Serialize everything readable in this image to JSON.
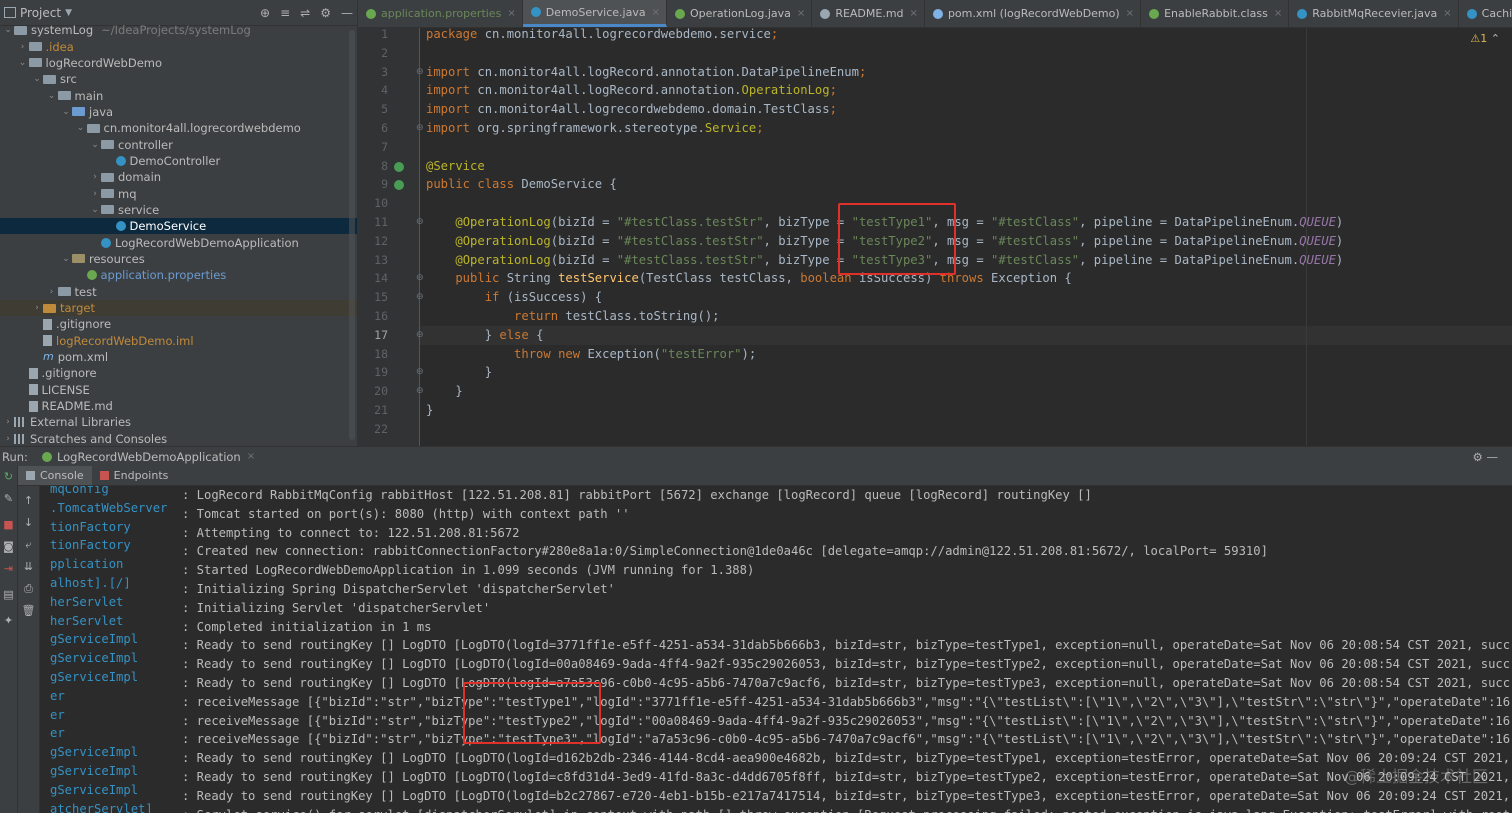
{
  "project": {
    "title": "Project",
    "tools": [
      "⊕",
      "≡",
      "⇌",
      "⚙",
      "—"
    ],
    "tree": [
      {
        "depth": 0,
        "arrow": "⌄",
        "icon": "folder",
        "label": "systemLog",
        "path": "~/IdeaProjects/systemLog",
        "color": "normal"
      },
      {
        "depth": 1,
        "arrow": "›",
        "icon": "folder",
        "label": ".idea",
        "color": "orange"
      },
      {
        "depth": 1,
        "arrow": "⌄",
        "icon": "folder",
        "label": "logRecordWebDemo",
        "color": "normal"
      },
      {
        "depth": 2,
        "arrow": "⌄",
        "icon": "folder",
        "label": "src",
        "color": "normal"
      },
      {
        "depth": 3,
        "arrow": "⌄",
        "icon": "folder",
        "label": "main",
        "color": "normal"
      },
      {
        "depth": 4,
        "arrow": "⌄",
        "icon": "folder blue",
        "label": "java",
        "color": "normal"
      },
      {
        "depth": 5,
        "arrow": "⌄",
        "icon": "folder",
        "label": "cn.monitor4all.logrecordwebdemo",
        "color": "normal"
      },
      {
        "depth": 6,
        "arrow": "⌄",
        "icon": "folder",
        "label": "controller",
        "color": "normal"
      },
      {
        "depth": 7,
        "arrow": "",
        "icon": "cls",
        "label": "DemoController",
        "color": "normal"
      },
      {
        "depth": 6,
        "arrow": "›",
        "icon": "folder",
        "label": "domain",
        "color": "normal"
      },
      {
        "depth": 6,
        "arrow": "›",
        "icon": "folder",
        "label": "mq",
        "color": "normal"
      },
      {
        "depth": 6,
        "arrow": "⌄",
        "icon": "folder",
        "label": "service",
        "color": "normal"
      },
      {
        "depth": 7,
        "arrow": "",
        "icon": "cls",
        "label": "DemoService",
        "color": "sel",
        "selected": true
      },
      {
        "depth": 6,
        "arrow": "",
        "icon": "cls",
        "label": "LogRecordWebDemoApplication",
        "color": "normal"
      },
      {
        "depth": 4,
        "arrow": "⌄",
        "icon": "folder res",
        "label": "resources",
        "color": "normal"
      },
      {
        "depth": 5,
        "arrow": "",
        "icon": "spring",
        "label": "application.properties",
        "color": "blue"
      },
      {
        "depth": 3,
        "arrow": "›",
        "icon": "folder",
        "label": "test",
        "color": "normal"
      },
      {
        "depth": 2,
        "arrow": "›",
        "icon": "folder orange",
        "label": "target",
        "color": "orange",
        "ignored": true
      },
      {
        "depth": 2,
        "arrow": "",
        "icon": "file",
        "label": ".gitignore",
        "color": "normal"
      },
      {
        "depth": 2,
        "arrow": "",
        "icon": "file",
        "label": "logRecordWebDemo.iml",
        "color": "orange"
      },
      {
        "depth": 2,
        "arrow": "",
        "icon": "mfile",
        "label": "pom.xml",
        "color": "normal"
      },
      {
        "depth": 1,
        "arrow": "",
        "icon": "file",
        "label": ".gitignore",
        "color": "normal"
      },
      {
        "depth": 1,
        "arrow": "",
        "icon": "file",
        "label": "LICENSE",
        "color": "normal"
      },
      {
        "depth": 1,
        "arrow": "",
        "icon": "file",
        "label": "README.md",
        "color": "normal"
      },
      {
        "depth": 0,
        "arrow": "›",
        "icon": "lib",
        "label": "External Libraries",
        "color": "normal"
      },
      {
        "depth": 0,
        "arrow": "›",
        "icon": "lib",
        "label": "Scratches and Consoles",
        "color": "normal"
      }
    ]
  },
  "tabs": [
    {
      "label": "application.properties",
      "color": "#6aa84f",
      "prop": true
    },
    {
      "label": "DemoService.java",
      "color": "#3592c4",
      "active": true
    },
    {
      "label": "OperationLog.java",
      "color": "#6aa84f"
    },
    {
      "label": "README.md",
      "color": "#9aa7b0"
    },
    {
      "label": "pom.xml (logRecordWebDemo)",
      "color": "#7fb2e5"
    },
    {
      "label": "EnableRabbit.class",
      "color": "#6aa84f"
    },
    {
      "label": "RabbitMqRecevier.java",
      "color": "#3592c4"
    },
    {
      "label": "CachingConnectionFac",
      "color": "#3592c4"
    }
  ],
  "editor": {
    "warning_count": "⚠1",
    "current_line": 17,
    "lines": [
      [
        [
          "kw",
          "package "
        ],
        [
          "cls2",
          "cn.monitor4all.logrecordwebdemo.service"
        ],
        [
          "kw",
          ";"
        ]
      ],
      [],
      [
        [
          "kw",
          "import "
        ],
        [
          "cls2",
          "cn.monitor4all.logRecord.annotation.DataPipelineEnum"
        ],
        [
          "kw",
          ";"
        ]
      ],
      [
        [
          "kw",
          "import "
        ],
        [
          "cls2",
          "cn.monitor4all.logRecord.annotation."
        ],
        [
          "an",
          "OperationLog"
        ],
        [
          "kw",
          ";"
        ]
      ],
      [
        [
          "kw",
          "import "
        ],
        [
          "cls2",
          "cn.monitor4all.logrecordwebdemo.domain.TestClass"
        ],
        [
          "kw",
          ";"
        ]
      ],
      [
        [
          "kw",
          "import "
        ],
        [
          "cls2",
          "org.springframework.stereotype."
        ],
        [
          "an",
          "Service"
        ],
        [
          "kw",
          ";"
        ]
      ],
      [],
      [
        [
          "an",
          "@Service"
        ]
      ],
      [
        [
          "kw",
          "public class "
        ],
        [
          "cls2",
          "DemoService {"
        ]
      ],
      [],
      [
        [
          "cls2",
          "    "
        ],
        [
          "an",
          "@OperationLog"
        ],
        [
          "cls2",
          "(bizId = "
        ],
        [
          "str",
          "\"#testClass.testStr\""
        ],
        [
          "cls2",
          ", bizType = "
        ],
        [
          "str",
          "\"testType1\""
        ],
        [
          "cls2",
          ", msg = "
        ],
        [
          "str",
          "\"#testClass\""
        ],
        [
          "cls2",
          ", pipeline = DataPipelineEnum."
        ],
        [
          "it",
          "QUEUE"
        ],
        [
          "cls2",
          ")"
        ]
      ],
      [
        [
          "cls2",
          "    "
        ],
        [
          "an",
          "@OperationLog"
        ],
        [
          "cls2",
          "(bizId = "
        ],
        [
          "str",
          "\"#testClass.testStr\""
        ],
        [
          "cls2",
          ", bizType = "
        ],
        [
          "str",
          "\"testType2\""
        ],
        [
          "cls2",
          ", msg = "
        ],
        [
          "str",
          "\"#testClass\""
        ],
        [
          "cls2",
          ", pipeline = DataPipelineEnum."
        ],
        [
          "it",
          "QUEUE"
        ],
        [
          "cls2",
          ")"
        ]
      ],
      [
        [
          "cls2",
          "    "
        ],
        [
          "an",
          "@OperationLog"
        ],
        [
          "cls2",
          "(bizId = "
        ],
        [
          "str",
          "\"#testClass.testStr\""
        ],
        [
          "cls2",
          ", bizType = "
        ],
        [
          "str",
          "\"testType3\""
        ],
        [
          "cls2",
          ", msg = "
        ],
        [
          "str",
          "\"#testClass\""
        ],
        [
          "cls2",
          ", pipeline = DataPipelineEnum."
        ],
        [
          "it",
          "QUEUE"
        ],
        [
          "cls2",
          ")"
        ]
      ],
      [
        [
          "kw",
          "    public "
        ],
        [
          "cls2",
          "String "
        ],
        [
          "fn",
          "testService"
        ],
        [
          "cls2",
          "(TestClass testClass, "
        ],
        [
          "kw",
          "boolean "
        ],
        [
          "cls2",
          "isSuccess) "
        ],
        [
          "kw",
          "throws "
        ],
        [
          "cls2",
          "Exception {"
        ]
      ],
      [
        [
          "kw",
          "        if "
        ],
        [
          "cls2",
          "(isSuccess) {"
        ]
      ],
      [
        [
          "kw",
          "            return "
        ],
        [
          "cls2",
          "testClass.toString();"
        ]
      ],
      [
        [
          "cls2",
          "        } "
        ],
        [
          "kw",
          "else "
        ],
        [
          "cls2",
          "{"
        ]
      ],
      [
        [
          "kw",
          "            throw new "
        ],
        [
          "cls2",
          "Exception("
        ],
        [
          "str",
          "\"testError\""
        ],
        [
          "cls2",
          ");"
        ]
      ],
      [
        [
          "cls2",
          "        }"
        ]
      ],
      [
        [
          "cls2",
          "    }"
        ]
      ],
      [
        [
          "cls2",
          "}"
        ]
      ],
      []
    ]
  },
  "run": {
    "label": "Run:",
    "config": "LogRecordWebDemoApplication",
    "subtabs": [
      "Console",
      "Endpoints"
    ],
    "log": [
      [
        "mqConfig",
        ": LogRecord RabbitMqConfig rabbitHost [122.51.208.81] rabbitPort [5672] exchange [logRecord] queue [logRecord] routingKey []"
      ],
      [
        ".TomcatWebServer",
        ": Tomcat started on port(s): 8080 (http) with context path ''"
      ],
      [
        "tionFactory",
        ": Attempting to connect to: 122.51.208.81:5672"
      ],
      [
        "tionFactory",
        ": Created new connection: rabbitConnectionFactory#280e8a1a:0/SimpleConnection@1de0a46c [delegate=amqp://admin@122.51.208.81:5672/, localPort= 59310]"
      ],
      [
        "pplication",
        ": Started LogRecordWebDemoApplication in 1.099 seconds (JVM running for 1.388)"
      ],
      [
        "alhost].[/]",
        ": Initializing Spring DispatcherServlet 'dispatcherServlet'"
      ],
      [
        "herServlet",
        ": Initializing Servlet 'dispatcherServlet'"
      ],
      [
        "herServlet",
        ": Completed initialization in 1 ms"
      ],
      [
        "gServiceImpl",
        ": Ready to send routingKey [] LogDTO [LogDTO(logId=3771ff1e-e5ff-4251-a534-31dab5b666b3, bizId=str, bizType=testType1, exception=null, operateDate=Sat Nov 06 20:08:54 CST 2021, succ"
      ],
      [
        "gServiceImpl",
        ": Ready to send routingKey [] LogDTO [LogDTO(logId=00a08469-9ada-4ff4-9a2f-935c29026053, bizId=str, bizType=testType2, exception=null, operateDate=Sat Nov 06 20:08:54 CST 2021, succ"
      ],
      [
        "gServiceImpl",
        ": Ready to send routingKey [] LogDTO [LogDTO(logId=a7a53c96-c0b0-4c95-a5b6-7470a7c9acf6, bizId=str, bizType=testType3, exception=null, operateDate=Sat Nov 06 20:08:54 CST 2021, succ"
      ],
      [
        "er",
        ": receiveMessage [{\"bizId\":\"str\",\"bizType\":\"testType1\",\"logId\":\"3771ff1e-e5ff-4251-a534-31dab5b666b3\",\"msg\":\"{\\\"testList\\\":[\\\"1\\\",\\\"2\\\",\\\"3\\\"],\\\"testStr\\\":\\\"str\\\"}\",\"operateDate\":16"
      ],
      [
        "er",
        ": receiveMessage [{\"bizId\":\"str\",\"bizType\":\"testType2\",\"logId\":\"00a08469-9ada-4ff4-9a2f-935c29026053\",\"msg\":\"{\\\"testList\\\":[\\\"1\\\",\\\"2\\\",\\\"3\\\"],\\\"testStr\\\":\\\"str\\\"}\",\"operateDate\":16"
      ],
      [
        "er",
        ": receiveMessage [{\"bizId\":\"str\",\"bizType\":\"testType3\",\"logId\":\"a7a53c96-c0b0-4c95-a5b6-7470a7c9acf6\",\"msg\":\"{\\\"testList\\\":[\\\"1\\\",\\\"2\\\",\\\"3\\\"],\\\"testStr\\\":\\\"str\\\"}\",\"operateDate\":16"
      ],
      [
        "gServiceImpl",
        ": Ready to send routingKey [] LogDTO [LogDTO(logId=d162b2db-2346-4144-8cd4-aea900e4682b, bizId=str, bizType=testType1, exception=testError, operateDate=Sat Nov 06 20:09:24 CST 2021,"
      ],
      [
        "gServiceImpl",
        ": Ready to send routingKey [] LogDTO [LogDTO(logId=c8fd31d4-3ed9-41fd-8a3c-d4dd6705f8ff, bizId=str, bizType=testType2, exception=testError, operateDate=Sat Nov 06 20:09:24 CST 2021,"
      ],
      [
        "gServiceImpl",
        ": Ready to send routingKey [] LogDTO [LogDTO(logId=b2c27867-e720-4eb1-b15b-e217a7417514, bizId=str, bizType=testType3, exception=testError, operateDate=Sat Nov 06 20:09:24 CST 2021,"
      ],
      [
        "atcherServlet]",
        ": Servlet.service() for servlet [dispatcherServlet] in context with path [] threw exception [Request processing failed; nested exception is java.lang.Exception: testError] with root"
      ]
    ]
  },
  "watermark": "@稀土掘金技术社区",
  "colors": {
    "accent": "#4a88c7",
    "highlight_box": "#e0302a"
  }
}
